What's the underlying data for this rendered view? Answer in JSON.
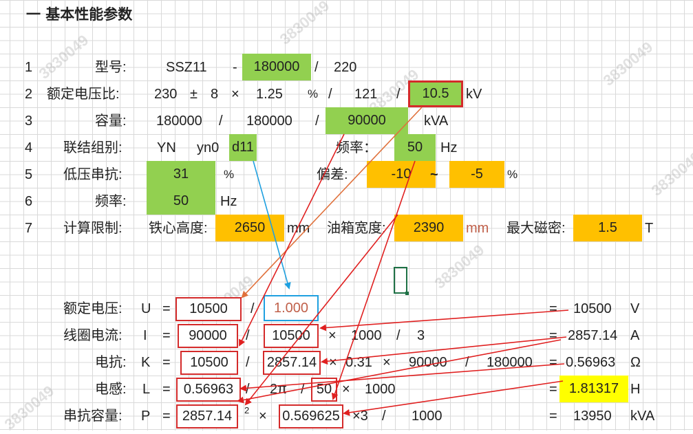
{
  "heading": "一  基本性能参数",
  "watermark": "3830049",
  "rows": {
    "r1": {
      "num": "1",
      "label": "型号:",
      "model": "SSZ11",
      "dash": "-",
      "capacity": "180000",
      "slash": "/",
      "voltage": "220"
    },
    "r2": {
      "num": "2",
      "label": "额定电压比:",
      "v1": "230",
      "pm": "±",
      "taps": "8",
      "times": "×",
      "step": "1.25",
      "pct": "%",
      "slash1": "/",
      "v2": "121",
      "slash2": "/",
      "v3": "10.5",
      "unit": "kV"
    },
    "r3": {
      "num": "3",
      "label": "容量:",
      "s1": "180000",
      "slash1": "/",
      "s2": "180000",
      "slash2": "/",
      "s3": "90000",
      "unit": "kVA"
    },
    "r4": {
      "num": "4",
      "label": "联结组别:",
      "g1": "YN",
      "g2": "yn0",
      "g3": "d11",
      "freq_label": "频率：",
      "freq": "50",
      "unit": "Hz"
    },
    "r5": {
      "num": "5",
      "label": "低压串抗:",
      "value": "31",
      "pct": "%",
      "dev_label": "偏差:",
      "dev_low": "-10",
      "tilde": "~",
      "dev_high": "-5",
      "pct2": "%"
    },
    "r6": {
      "num": "6",
      "label": "频率:",
      "value": "50",
      "unit": "Hz"
    },
    "r7": {
      "num": "7",
      "label": "计算限制:",
      "core_label": "铁心高度:",
      "core": "2650",
      "mm1": "mm",
      "tank_label": "油箱宽度:",
      "tank": "2390",
      "mm2": "mm",
      "flux_label": "最大磁密:",
      "flux": "1.5",
      "unit": "T"
    }
  },
  "calc": {
    "U": {
      "label": "额定电压:",
      "sym": "U",
      "eq": "=",
      "a": "10500",
      "slash": "/",
      "b": "1.000",
      "eq2": "=",
      "result": "10500",
      "unit": "V"
    },
    "I": {
      "label": "线圈电流:",
      "sym": "I",
      "eq": "=",
      "a": "90000",
      "slash": "/",
      "b": "10500",
      "times": "×",
      "c": "1000",
      "slash2": "/",
      "d": "3",
      "eq2": "=",
      "result": "2857.14",
      "unit": "A"
    },
    "K": {
      "label": "电抗:",
      "sym": "K",
      "eq": "=",
      "a": "10500",
      "slash": "/",
      "b": "2857.14",
      "times": "×",
      "c": "0.31",
      "times2": "×",
      "d": "90000",
      "slash2": "/",
      "e": "180000",
      "eq2": "=",
      "result": "0.56963",
      "unit": "Ω"
    },
    "L": {
      "label": "电感:",
      "sym": "L",
      "eq": "=",
      "a": "0.56963",
      "slash": "/",
      "b": "2π",
      "slash2": "/",
      "c": "50",
      "times": "×",
      "d": "1000",
      "eq2": "=",
      "result": "1.81317",
      "unit": "H"
    },
    "P": {
      "label": "串抗容量:",
      "sym": "P",
      "eq": "=",
      "a": "2857.14",
      "sup": "2",
      "times": "×",
      "b": "0.569625",
      "times3": "×3",
      "slash": "/",
      "c": "1000",
      "eq2": "=",
      "result": "13950",
      "unit": "kVA"
    }
  },
  "colors": {
    "green": "#92d050",
    "orange": "#ffc000",
    "yellow": "#ffff00",
    "red_box": "#d42a2a",
    "blue_box": "#1ea0e0"
  }
}
